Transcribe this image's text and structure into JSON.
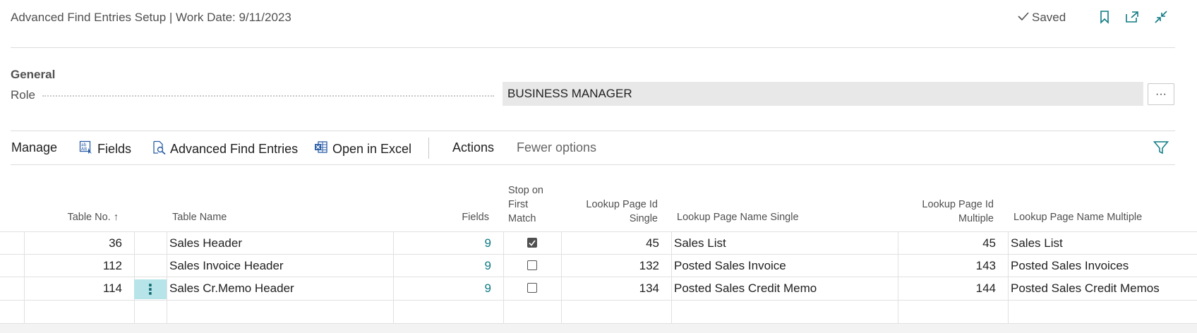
{
  "header": {
    "title": "Advanced Find Entries Setup | Work Date: 9/11/2023",
    "saved_label": "Saved"
  },
  "general": {
    "group_title": "General",
    "role_label": "Role",
    "role_value": "BUSINESS MANAGER",
    "lookup_label": "···"
  },
  "actions": {
    "manage": "Manage",
    "fields": "Fields",
    "advanced_find_entries": "Advanced Find Entries",
    "open_in_excel": "Open in Excel",
    "actions": "Actions",
    "fewer_options": "Fewer options"
  },
  "table": {
    "headers": {
      "table_no": "Table No. ↑",
      "table_name": "Table Name",
      "fields": "Fields",
      "stop_line1": "Stop on",
      "stop_line2": "First",
      "stop_line3": "Match",
      "lps_line1": "Lookup Page Id",
      "lps_line2": "Single",
      "lpns": "Lookup Page Name Single",
      "lpm_line1": "Lookup Page Id",
      "lpm_line2": "Multiple",
      "lpnm": "Lookup Page Name Multiple"
    },
    "rows": [
      {
        "table_no": "36",
        "table_name": "Sales Header",
        "fields": "9",
        "stop": true,
        "lp_single": "45",
        "lp_name_single": "Sales List",
        "lp_multiple": "45",
        "lp_name_multiple": "Sales List"
      },
      {
        "table_no": "112",
        "table_name": "Sales Invoice Header",
        "fields": "9",
        "stop": false,
        "lp_single": "132",
        "lp_name_single": "Posted Sales Invoice",
        "lp_multiple": "143",
        "lp_name_multiple": "Posted Sales Invoices"
      },
      {
        "table_no": "114",
        "table_name": "Sales Cr.Memo Header",
        "fields": "9",
        "stop": false,
        "lp_single": "134",
        "lp_name_single": "Posted Sales Credit Memo",
        "lp_multiple": "144",
        "lp_name_multiple": "Posted Sales Credit Memos"
      }
    ],
    "row_menu_icon": "vertical-ellipsis"
  },
  "colors": {
    "link": "#0e7a83",
    "selection": "#b6e4e8",
    "accent": "#0e7a83"
  }
}
